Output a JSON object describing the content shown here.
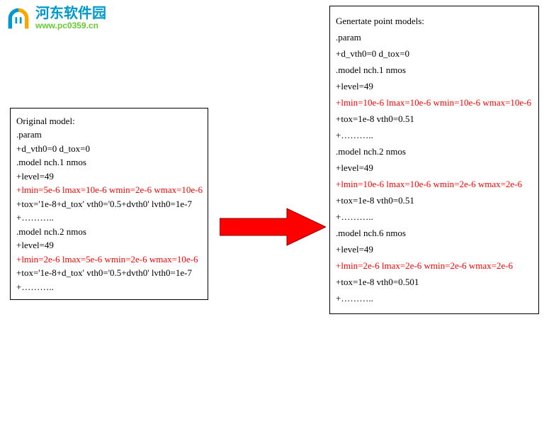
{
  "watermark": {
    "name": "河东软件园",
    "url": "www.pc0359.cn"
  },
  "left_box": {
    "title": "Original model:",
    "lines": [
      {
        "text": ".param",
        "red": false
      },
      {
        "text": "+d_vth0=0 d_tox=0",
        "red": false
      },
      {
        "text": ".model nch.1 nmos",
        "red": false
      },
      {
        "text": "+level=49",
        "red": false
      },
      {
        "text": "+lmin=5e-6 lmax=10e-6 wmin=2e-6 wmax=10e-6",
        "red": true
      },
      {
        "text": "+tox='1e-8+d_tox' vth0='0.5+dvth0' lvth0=1e-7",
        "red": false
      },
      {
        "text": "+………..",
        "red": false
      },
      {
        "text": ".model nch.2 nmos",
        "red": false
      },
      {
        "text": "+level=49",
        "red": false
      },
      {
        "text": "+lmin=2e-6 lmax=5e-6 wmin=2e-6 wmax=10e-6",
        "red": true
      },
      {
        "text": "+tox='1e-8+d_tox' vth0='0.5+dvth0' lvth0=1e-7",
        "red": false
      },
      {
        "text": "+………..",
        "red": false
      }
    ]
  },
  "right_box": {
    "title": "Genertate point models:",
    "lines": [
      {
        "text": ".param",
        "red": false
      },
      {
        "text": "+d_vth0=0 d_tox=0",
        "red": false
      },
      {
        "text": ".model nch.1 nmos",
        "red": false
      },
      {
        "text": "+level=49",
        "red": false
      },
      {
        "text": "+lmin=10e-6 lmax=10e-6 wmin=10e-6 wmax=10e-6",
        "red": true
      },
      {
        "text": "+tox=1e-8 vth0=0.51",
        "red": false
      },
      {
        "text": "+………..",
        "red": false
      },
      {
        "text": ".model nch.2 nmos",
        "red": false
      },
      {
        "text": "+level=49",
        "red": false
      },
      {
        "text": "+lmin=10e-6 lmax=10e-6 wmin=2e-6 wmax=2e-6",
        "red": true
      },
      {
        "text": "+tox=1e-8 vth0=0.51",
        "red": false
      },
      {
        "text": "+………..",
        "red": false
      },
      {
        "text": ".model nch.6 nmos",
        "red": false
      },
      {
        "text": "+level=49",
        "red": false
      },
      {
        "text": "+lmin=2e-6 lmax=2e-6 wmin=2e-6 wmax=2e-6",
        "red": true
      },
      {
        "text": "+tox=1e-8 vth0=0.501",
        "red": false
      },
      {
        "text": "+………..",
        "red": false
      }
    ]
  }
}
